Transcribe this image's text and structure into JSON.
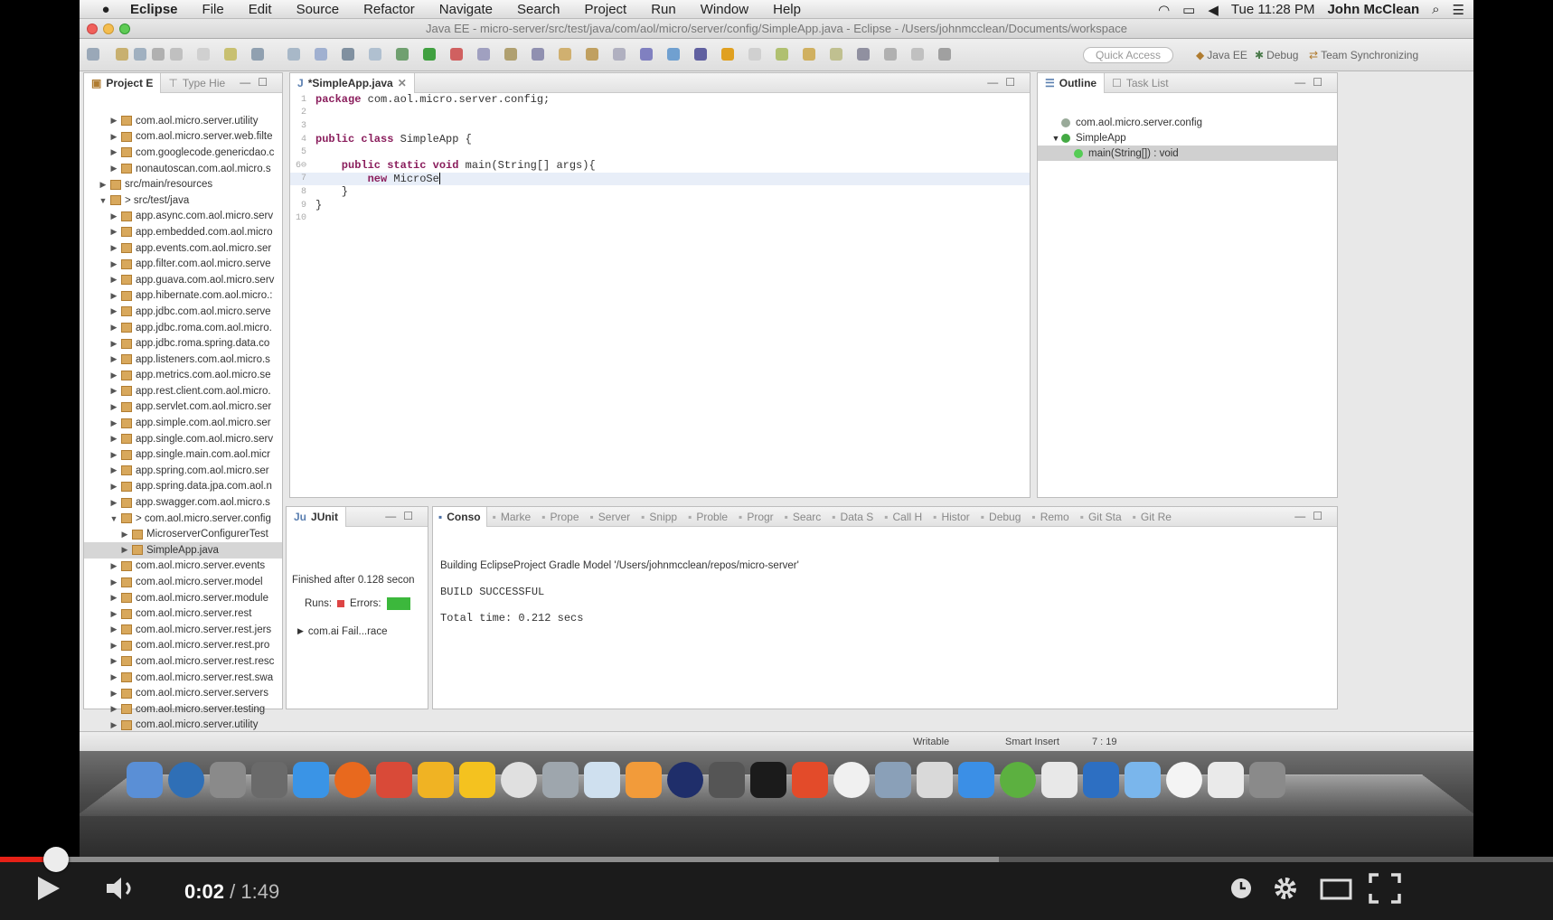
{
  "menubar": {
    "app": "Eclipse",
    "items": [
      "File",
      "Edit",
      "Source",
      "Refactor",
      "Navigate",
      "Search",
      "Project",
      "Run",
      "Window",
      "Help"
    ],
    "clock": "Tue 11:28 PM",
    "user": "John McClean"
  },
  "window_title": "Java EE - micro-server/src/test/java/com/aol/micro/server/config/SimpleApp.java - Eclipse - /Users/johnmcclean/Documents/workspace",
  "toolbar": {
    "quick_access": "Quick Access",
    "perspectives": [
      "Java EE",
      "Debug",
      "Team Synchronizing"
    ]
  },
  "project_explorer": {
    "tabs": [
      "Project E",
      "Type Hie"
    ],
    "items": [
      {
        "label": "com.aol.micro.server.utility",
        "indent": 2,
        "arrow": "▶"
      },
      {
        "label": "com.aol.micro.server.web.filte",
        "indent": 2,
        "arrow": "▶"
      },
      {
        "label": "com.googlecode.genericdao.c",
        "indent": 2,
        "arrow": "▶"
      },
      {
        "label": "nonautoscan.com.aol.micro.s",
        "indent": 2,
        "arrow": "▶"
      },
      {
        "label": "src/main/resources",
        "indent": 1,
        "arrow": "▶"
      },
      {
        "label": "> src/test/java",
        "indent": 1,
        "arrow": "▼"
      },
      {
        "label": "app.async.com.aol.micro.serv",
        "indent": 2,
        "arrow": "▶"
      },
      {
        "label": "app.embedded.com.aol.micro",
        "indent": 2,
        "arrow": "▶"
      },
      {
        "label": "app.events.com.aol.micro.ser",
        "indent": 2,
        "arrow": "▶"
      },
      {
        "label": "app.filter.com.aol.micro.serve",
        "indent": 2,
        "arrow": "▶"
      },
      {
        "label": "app.guava.com.aol.micro.serv",
        "indent": 2,
        "arrow": "▶"
      },
      {
        "label": "app.hibernate.com.aol.micro.:",
        "indent": 2,
        "arrow": "▶"
      },
      {
        "label": "app.jdbc.com.aol.micro.serve",
        "indent": 2,
        "arrow": "▶"
      },
      {
        "label": "app.jdbc.roma.com.aol.micro.",
        "indent": 2,
        "arrow": "▶"
      },
      {
        "label": "app.jdbc.roma.spring.data.co",
        "indent": 2,
        "arrow": "▶"
      },
      {
        "label": "app.listeners.com.aol.micro.s",
        "indent": 2,
        "arrow": "▶"
      },
      {
        "label": "app.metrics.com.aol.micro.se",
        "indent": 2,
        "arrow": "▶"
      },
      {
        "label": "app.rest.client.com.aol.micro.",
        "indent": 2,
        "arrow": "▶"
      },
      {
        "label": "app.servlet.com.aol.micro.ser",
        "indent": 2,
        "arrow": "▶"
      },
      {
        "label": "app.simple.com.aol.micro.ser",
        "indent": 2,
        "arrow": "▶"
      },
      {
        "label": "app.single.com.aol.micro.serv",
        "indent": 2,
        "arrow": "▶"
      },
      {
        "label": "app.single.main.com.aol.micr",
        "indent": 2,
        "arrow": "▶"
      },
      {
        "label": "app.spring.com.aol.micro.ser",
        "indent": 2,
        "arrow": "▶"
      },
      {
        "label": "app.spring.data.jpa.com.aol.n",
        "indent": 2,
        "arrow": "▶"
      },
      {
        "label": "app.swagger.com.aol.micro.s",
        "indent": 2,
        "arrow": "▶"
      },
      {
        "label": "> com.aol.micro.server.config",
        "indent": 2,
        "arrow": "▼"
      },
      {
        "label": "MicroserverConfigurerTest",
        "indent": 3,
        "arrow": "▶"
      },
      {
        "label": "SimpleApp.java",
        "indent": 3,
        "arrow": "▶",
        "selected": true
      },
      {
        "label": "com.aol.micro.server.events",
        "indent": 2,
        "arrow": "▶"
      },
      {
        "label": "com.aol.micro.server.model",
        "indent": 2,
        "arrow": "▶"
      },
      {
        "label": "com.aol.micro.server.module",
        "indent": 2,
        "arrow": "▶"
      },
      {
        "label": "com.aol.micro.server.rest",
        "indent": 2,
        "arrow": "▶"
      },
      {
        "label": "com.aol.micro.server.rest.jers",
        "indent": 2,
        "arrow": "▶"
      },
      {
        "label": "com.aol.micro.server.rest.pro",
        "indent": 2,
        "arrow": "▶"
      },
      {
        "label": "com.aol.micro.server.rest.resc",
        "indent": 2,
        "arrow": "▶"
      },
      {
        "label": "com.aol.micro.server.rest.swa",
        "indent": 2,
        "arrow": "▶"
      },
      {
        "label": "com.aol.micro.server.servers",
        "indent": 2,
        "arrow": "▶"
      },
      {
        "label": "com.aol.micro.server.testing",
        "indent": 2,
        "arrow": "▶"
      },
      {
        "label": "com.aol.micro.server.utility",
        "indent": 2,
        "arrow": "▶"
      }
    ]
  },
  "editor": {
    "tab": "*SimpleApp.java",
    "lines": [
      {
        "n": "1",
        "kw": "package",
        "rest": " com.aol.micro.server.config;"
      },
      {
        "n": "2",
        "kw": "",
        "rest": ""
      },
      {
        "n": "3",
        "kw": "",
        "rest": ""
      },
      {
        "n": "4",
        "kw": "public class",
        "rest": " SimpleApp {"
      },
      {
        "n": "5",
        "kw": "",
        "rest": ""
      },
      {
        "n": "6⊖",
        "kw": "    public static void",
        "rest": " main(String[] args){"
      },
      {
        "n": "7",
        "kw": "        new",
        "rest": " MicroSe",
        "cursor": true
      },
      {
        "n": "8",
        "kw": "",
        "rest": "    }"
      },
      {
        "n": "9",
        "kw": "",
        "rest": "}"
      },
      {
        "n": "10",
        "kw": "",
        "rest": ""
      }
    ]
  },
  "outline": {
    "tabs": [
      "Outline",
      "Task List"
    ],
    "items": [
      {
        "label": "com.aol.micro.server.config",
        "indent": 1
      },
      {
        "label": "SimpleApp",
        "indent": 1,
        "arrow": "▼"
      },
      {
        "label": "main(String[]) : void",
        "indent": 2,
        "selected": true
      }
    ]
  },
  "junit": {
    "tab": "JUnit",
    "finished": "Finished after 0.128 secon",
    "runs_label": "Runs:",
    "errors_label": "Errors:",
    "node": "com.ai Fail...race"
  },
  "console": {
    "tabs": [
      "Conso",
      "Marke",
      "Prope",
      "Server",
      "Snipp",
      "Proble",
      "Progr",
      "Searc",
      "Data S",
      "Call H",
      "Histor",
      "Debug",
      "Remo",
      "Git Sta",
      "Git Re"
    ],
    "lines": [
      "Building EclipseProject Gradle Model '/Users/johnmcclean/repos/micro-server'",
      "BUILD SUCCESSFUL",
      "Total time: 0.212 secs"
    ]
  },
  "statusbar": {
    "writable": "Writable",
    "insert": "Smart Insert",
    "pos": "7 : 19"
  },
  "dock": {
    "colors": [
      "#5a8fd6",
      "#2f6fb6",
      "#8a8a8a",
      "#6a6a6a",
      "#3a94e6",
      "#e8691e",
      "#d94a38",
      "#f0b323",
      "#f4c21f",
      "#e0e0e0",
      "#9ea6ad",
      "#cfe0ef",
      "#f29b3a",
      "#1f2e6a",
      "#555",
      "#1b1b1b",
      "#e34b2a",
      "#f0f0f0",
      "#8aa0b8",
      "#d9d9d9",
      "#3b8fe6",
      "#5cb040",
      "#e8e8e8",
      "#2d6fc2",
      "#7ab6ec",
      "#f4f4f4",
      "#eaeaea",
      "#8a8a8a"
    ]
  },
  "player": {
    "current": "0:02",
    "total": "1:49",
    "progress_fraction": 0.018,
    "buffered_fraction": 0.643
  }
}
